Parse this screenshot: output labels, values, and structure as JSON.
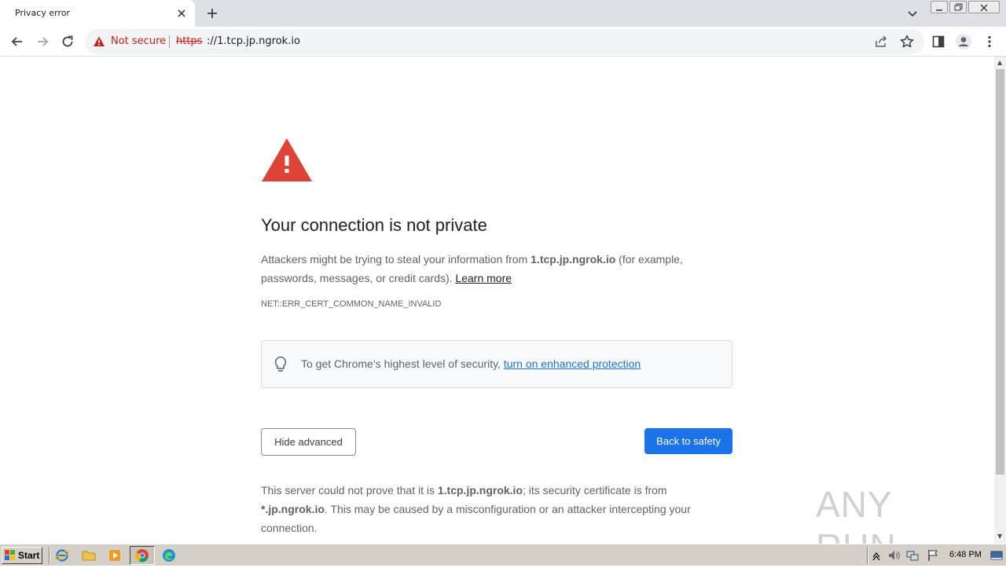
{
  "browser": {
    "tab_title": "Privacy error",
    "security_label": "Not secure",
    "url_scheme": "https",
    "url_rest": "://1.tcp.jp.ngrok.io"
  },
  "page": {
    "heading": "Your connection is not private",
    "explanation_prefix": "Attackers might be trying to steal your information from ",
    "explanation_host": "1.tcp.jp.ngrok.io",
    "explanation_suffix": " (for example, passwords, messages, or credit cards). ",
    "learn_more": "Learn more",
    "error_code": "NET::ERR_CERT_COMMON_NAME_INVALID",
    "promo_text": "To get Chrome’s highest level of security, ",
    "promo_link": "turn on enhanced protection",
    "hide_advanced": "Hide advanced",
    "back_to_safety": "Back to safety",
    "details_1": "This server could not prove that it is ",
    "details_host": "1.tcp.jp.ngrok.io",
    "details_2": "; its security certificate is from ",
    "details_cert": "*.jp.ngrok.io",
    "details_3": ". This may be caused by a misconfiguration or an attacker intercepting your connection."
  },
  "watermark": "ANY RUN",
  "taskbar": {
    "start_label": "Start",
    "clock": "6:48 PM"
  },
  "colors": {
    "danger": "#c5221f",
    "alert_red": "#db4437",
    "link_blue": "#1a73e8"
  }
}
